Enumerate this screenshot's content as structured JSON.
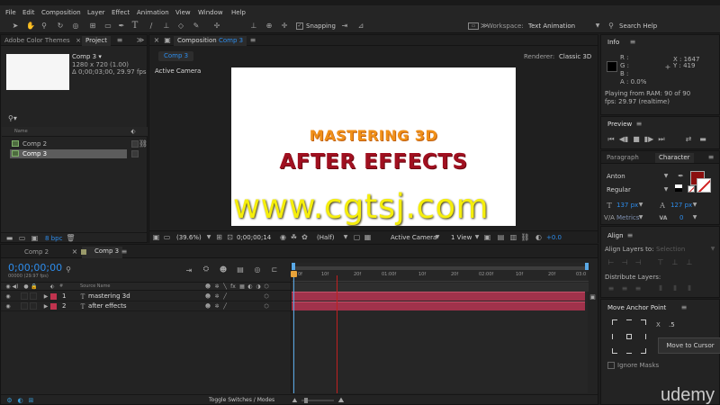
{
  "menu": [
    "File",
    "Edit",
    "Composition",
    "Layer",
    "Effect",
    "Animation",
    "View",
    "Window",
    "Help"
  ],
  "toolbar": {
    "snapping": "Snapping",
    "workspace_label": "Workspace:",
    "workspace_value": "Text Animation",
    "search_placeholder": "Search Help"
  },
  "left_panel": {
    "tabs": [
      "Adobe Color Themes",
      "Project"
    ],
    "comp_name": "Comp 3 ▾",
    "comp_size": "1280 x 720 (1.00)",
    "comp_duration": "Δ 0;00;03;00, 29.97 fps",
    "search_icon": "⚲▾",
    "col_name": "Name",
    "items": [
      "Comp 2",
      "Comp 3"
    ],
    "bpc": "8 bpc"
  },
  "comp_viewer": {
    "tab_label": "Composition",
    "tab_comp": "Comp 3",
    "sub_tab": "Comp 3",
    "renderer_label": "Renderer:",
    "renderer_value": "Classic 3D",
    "active_camera": "Active Camera",
    "title_line1": "MASTERING 3D",
    "title_line2": "AFTER EFFECTS",
    "watermark": "www.cgtsj.com",
    "zoom": "(39.6%)",
    "timecode": "0;00;00;14",
    "resolution": "(Half)",
    "camera": "Active Camera",
    "views": "1 View",
    "exposure": "+0.0"
  },
  "info": {
    "title": "Info",
    "r": "R :",
    "g": "G :",
    "b": "B :",
    "a": "A : 0.0%",
    "x": "X : 1647",
    "y": "Y : 419",
    "playing": "Playing from RAM: 90 of 90",
    "fps": "fps: 29.97 (realtime)"
  },
  "preview": {
    "title": "Preview"
  },
  "character": {
    "tab_paragraph": "Paragraph",
    "tab_character": "Character",
    "font": "Anton",
    "style": "Regular",
    "size": "137 px",
    "leading": "127 px",
    "kerning": "Metrics",
    "tracking": "0",
    "fill_color": "#8b0f0f"
  },
  "align": {
    "title": "Align",
    "align_to_label": "Align Layers to:",
    "align_to_value": "Selection",
    "distribute": "Distribute Layers:"
  },
  "anchor": {
    "title": "Move Anchor Point",
    "x_label": "X",
    "x_value": ".5",
    "move_button": "Move to Cursor",
    "ignore_masks": "Ignore Masks"
  },
  "timeline": {
    "tabs": [
      "Comp 2",
      "Comp 3"
    ],
    "timecode": "0;00;00;00",
    "frame_info": "00000 (29.97 fps)",
    "col_source": "Source Name",
    "layers": [
      {
        "num": "1",
        "name": "mastering 3d"
      },
      {
        "num": "2",
        "name": "after effects"
      }
    ],
    "ruler": [
      "0f",
      "10f",
      "20f",
      "01:00f",
      "10f",
      "20f",
      "02:00f",
      "10f",
      "20f",
      "03:0"
    ],
    "toggle": "Toggle Switches / Modes",
    "layer_color": "#a0324b"
  },
  "brand": "udemy"
}
